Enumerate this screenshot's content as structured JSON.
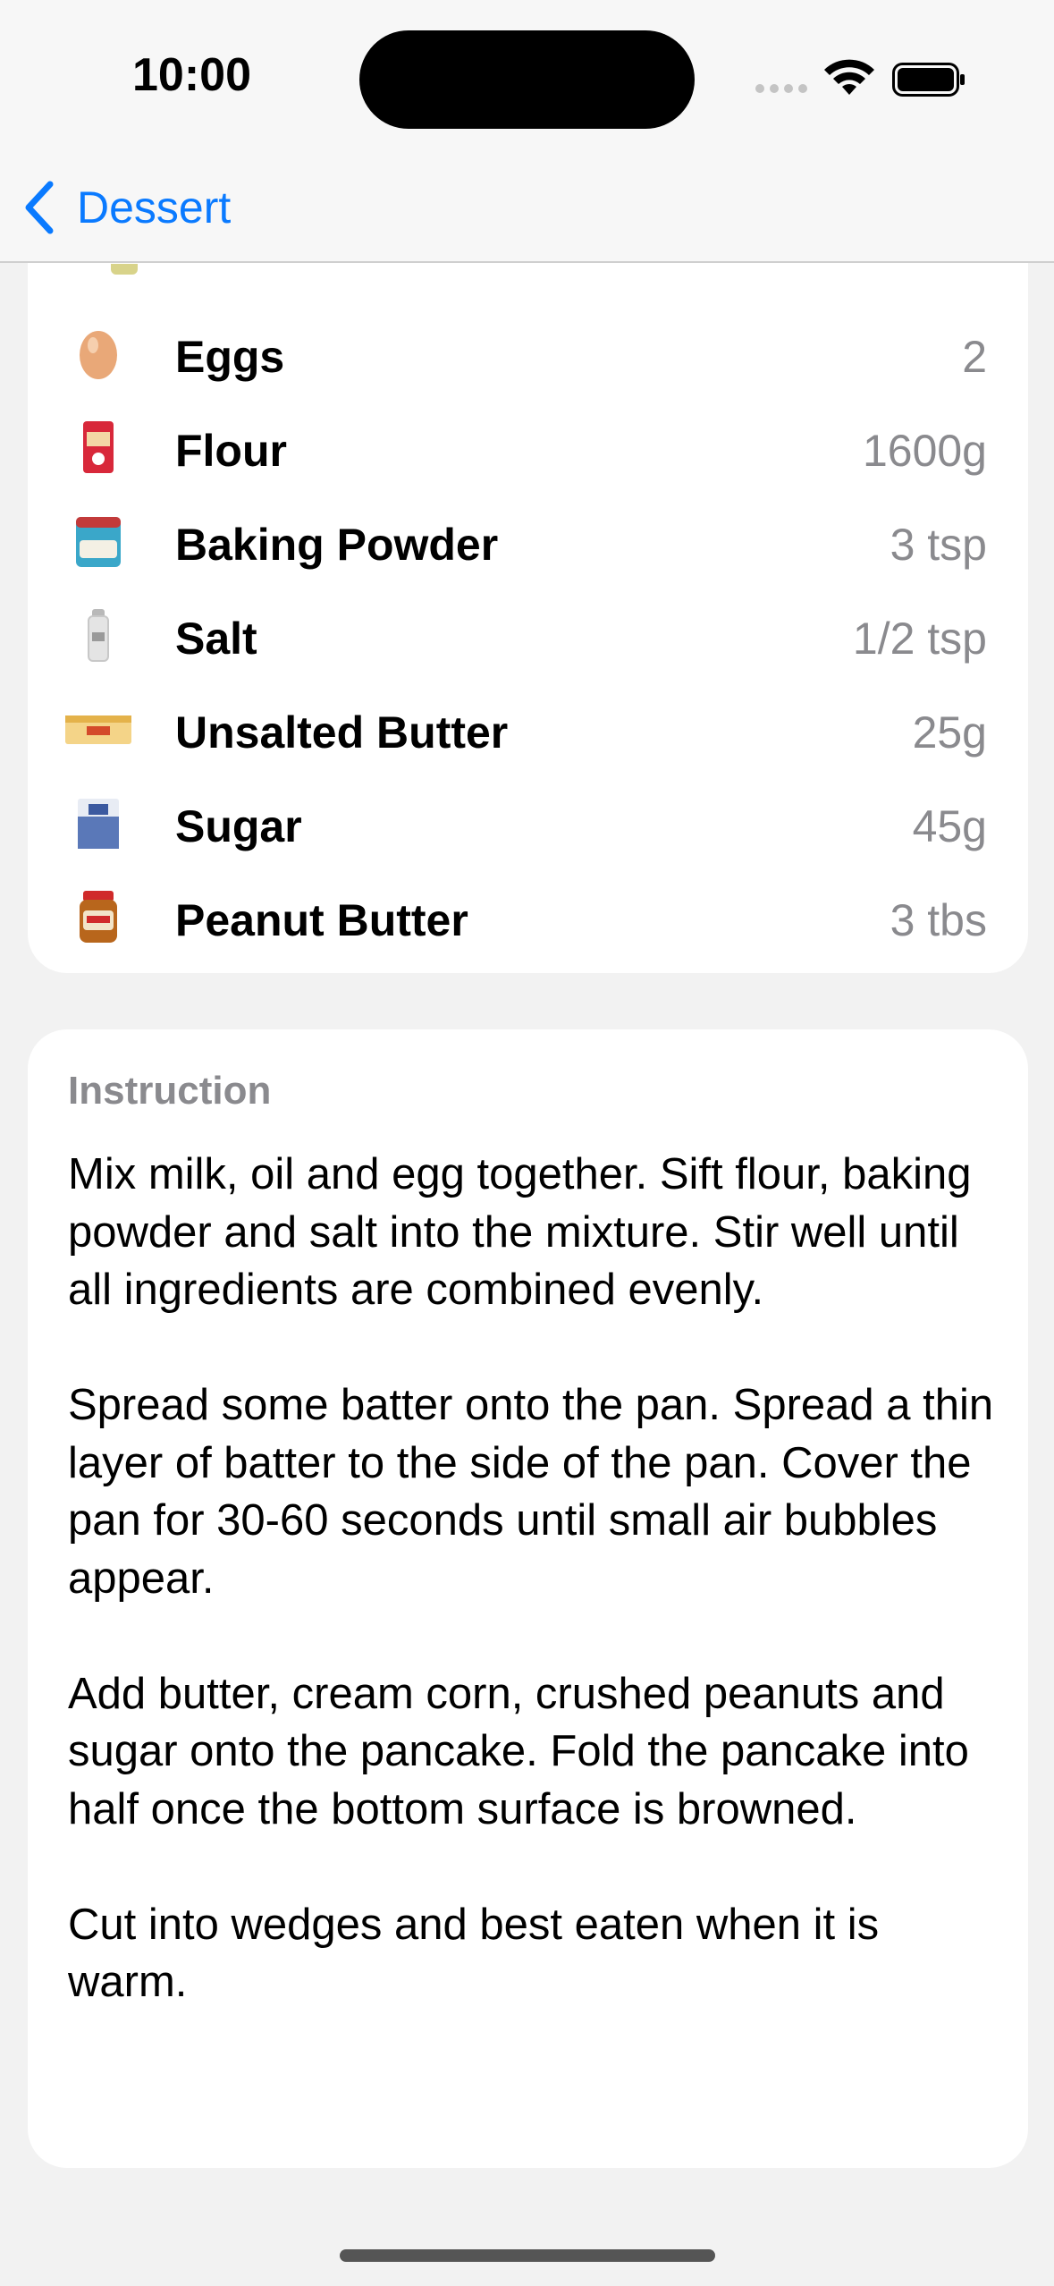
{
  "status_bar": {
    "time": "10:00",
    "signal_icon": "cellular-dots-icon",
    "wifi_icon": "wifi-icon",
    "battery_icon": "battery-full-icon"
  },
  "nav": {
    "back_label": "Dessert",
    "back_icon": "chevron-left-icon",
    "accent_color": "#0a7aff"
  },
  "ingredients": [
    {
      "name": "Eggs",
      "quantity": "2",
      "icon": "egg-icon"
    },
    {
      "name": "Flour",
      "quantity": "1600g",
      "icon": "flour-icon"
    },
    {
      "name": "Baking Powder",
      "quantity": "3 tsp",
      "icon": "baking-powder-icon"
    },
    {
      "name": "Salt",
      "quantity": "1/2 tsp",
      "icon": "salt-icon"
    },
    {
      "name": "Unsalted Butter",
      "quantity": "25g",
      "icon": "butter-icon"
    },
    {
      "name": "Sugar",
      "quantity": "45g",
      "icon": "sugar-icon"
    },
    {
      "name": "Peanut Butter",
      "quantity": "3 tbs",
      "icon": "peanut-butter-icon"
    }
  ],
  "instruction": {
    "heading": "Instruction",
    "paragraphs": [
      "Mix milk, oil and egg together. Sift flour, baking powder and salt into the mixture. Stir well until all ingredients are combined evenly.",
      "Spread some batter onto the pan. Spread a thin layer of batter to the side of the pan. Cover the pan for 30-60 seconds until small air bubbles appear.",
      "Add butter, cream corn, crushed peanuts and sugar onto the pancake. Fold the pancake into half once the bottom surface is browned.",
      "Cut into wedges and best eaten when it is warm."
    ]
  }
}
